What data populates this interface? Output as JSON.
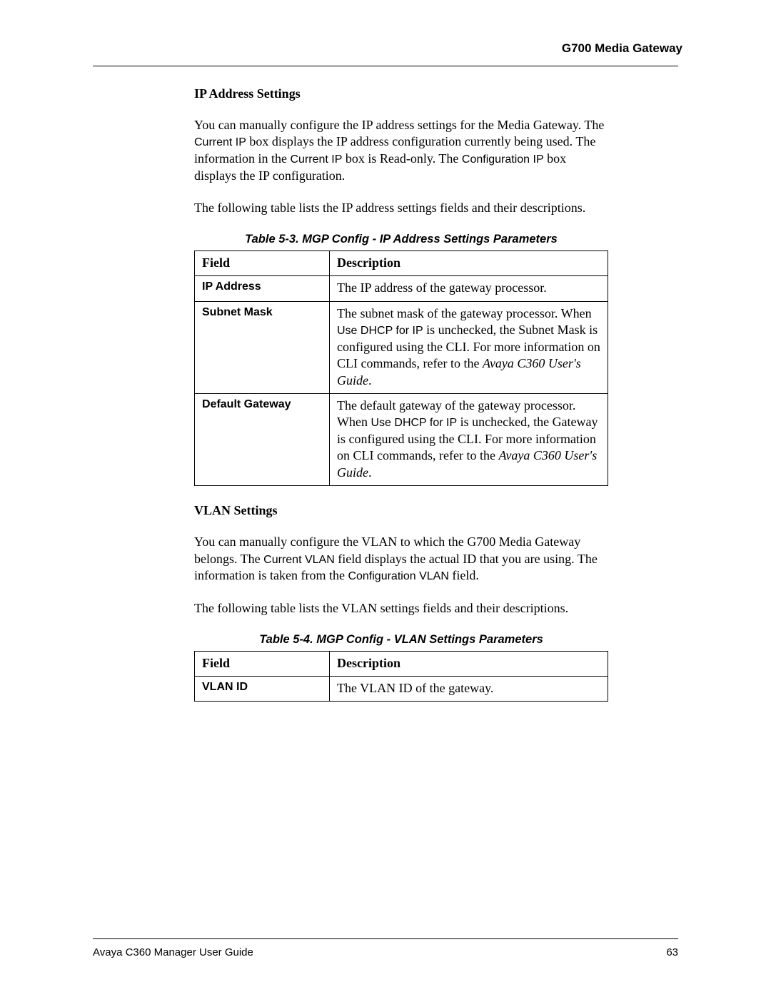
{
  "header": {
    "running_title": "G700 Media Gateway"
  },
  "sections": {
    "ip": {
      "heading": "IP Address Settings",
      "para1_a": "You can manually configure the IP address settings for the Media Gateway. The ",
      "para1_b": "Current IP",
      "para1_c": " box displays the IP address configuration currently being used. The information in the ",
      "para1_d": "Current IP",
      "para1_e": " box is Read-only. The ",
      "para1_f": "Configuration IP",
      "para1_g": " box displays the IP configuration.",
      "para2": "The following table lists the IP address settings fields and their descriptions.",
      "caption": "Table 5-3.  MGP Config - IP Address Settings Parameters",
      "th_field": "Field",
      "th_desc": "Description",
      "rows": {
        "r0": {
          "field": "IP Address",
          "desc": "The IP address of the gateway processor."
        },
        "r1": {
          "field": "Subnet Mask",
          "d1": "The subnet mask of the gateway processor. When ",
          "d2": "Use DHCP for IP",
          "d3": " is unchecked, the Subnet Mask is configured using the CLI. For more information on CLI commands, refer to the ",
          "d4": "Avaya C360 User's Guide",
          "d5": "."
        },
        "r2": {
          "field": "Default Gateway",
          "d1": "The default gateway of the gateway processor. When ",
          "d2": "Use DHCP for IP",
          "d3": " is unchecked, the Gateway is configured using the CLI. For more information on CLI commands, refer to the ",
          "d4": "Avaya C360 User's Guide",
          "d5": "."
        }
      }
    },
    "vlan": {
      "heading": "VLAN Settings",
      "para1_a": "You can manually configure the VLAN to which the G700 Media Gateway belongs. The ",
      "para1_b": "Current VLAN",
      "para1_c": " field displays the actual ID that you are using. The information is taken from the ",
      "para1_d": "Configuration VLAN",
      "para1_e": " field.",
      "para2": "The following table lists the VLAN settings fields and their descriptions.",
      "caption": "Table 5-4.  MGP Config - VLAN Settings Parameters",
      "th_field": "Field",
      "th_desc": "Description",
      "rows": {
        "r0": {
          "field": "VLAN ID",
          "desc": "The VLAN ID of the gateway."
        }
      }
    }
  },
  "footer": {
    "guide": "Avaya C360 Manager User Guide",
    "page": "63"
  }
}
